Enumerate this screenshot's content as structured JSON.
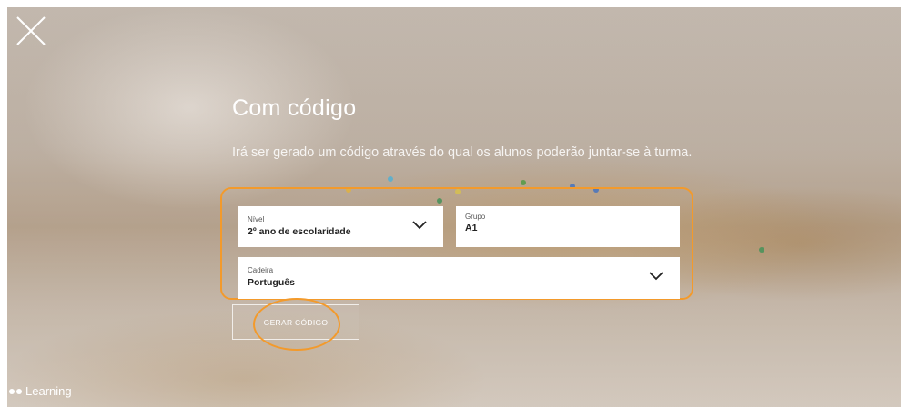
{
  "page": {
    "title": "Com código",
    "description": "Irá ser gerado um código através do qual os alunos poderão juntar-se à turma."
  },
  "form": {
    "nivel": {
      "label": "Nível",
      "value": "2º ano de escolaridade"
    },
    "grupo": {
      "label": "Grupo",
      "value": "A1"
    },
    "cadeira": {
      "label": "Cadeira",
      "value": "Português"
    }
  },
  "actions": {
    "generate_label": "GERAR CÓDIGO"
  },
  "brand": {
    "name": "Learning"
  },
  "colors": {
    "highlight": "#f39a2b",
    "text": "#ffffff",
    "field_bg": "#ffffff"
  },
  "icons": {
    "close": "close-icon",
    "chevron": "chevron-down-icon",
    "brand": "brand-dots-icon"
  }
}
